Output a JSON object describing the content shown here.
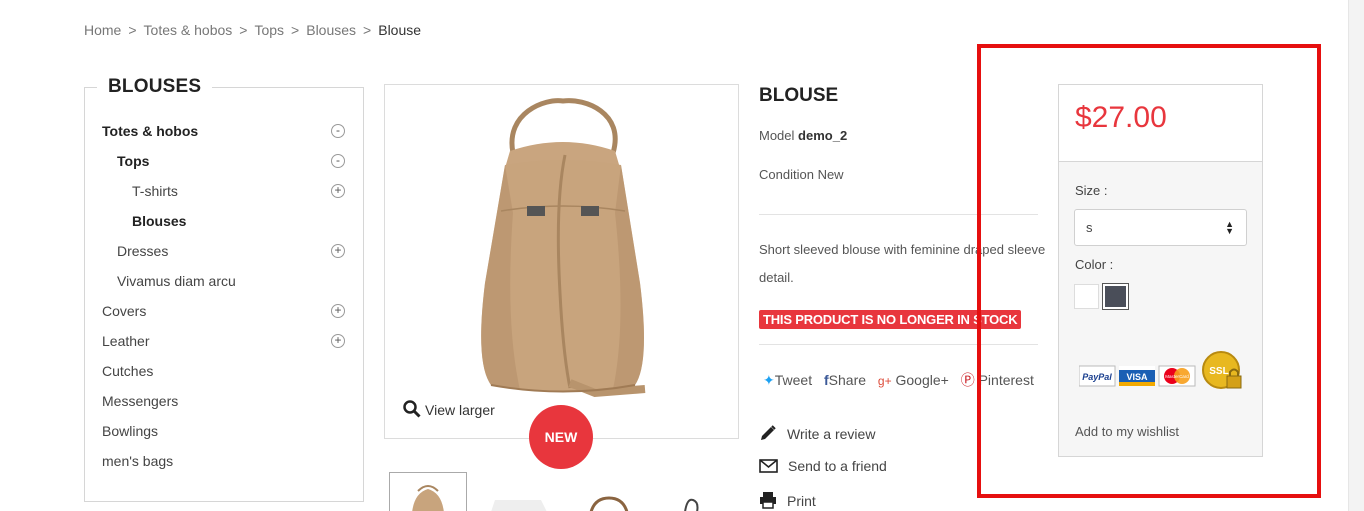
{
  "breadcrumb": {
    "items": [
      "Home",
      "Totes & hobos",
      "Tops",
      "Blouses"
    ],
    "current": "Blouse",
    "separator": ">"
  },
  "sidebar": {
    "title": "BLOUSES",
    "categories": [
      {
        "label": "Totes & hobos",
        "toggle": "-"
      },
      {
        "label": "Tops",
        "toggle": "-"
      },
      {
        "label": "T-shirts",
        "toggle": "+"
      },
      {
        "label": "Blouses",
        "toggle": ""
      },
      {
        "label": "Dresses",
        "toggle": "+"
      },
      {
        "label": "Vivamus diam arcu",
        "toggle": ""
      },
      {
        "label": "Covers",
        "toggle": "+"
      },
      {
        "label": "Leather",
        "toggle": "+"
      },
      {
        "label": "Cutches",
        "toggle": ""
      },
      {
        "label": "Messengers",
        "toggle": ""
      },
      {
        "label": "Bowlings",
        "toggle": ""
      },
      {
        "label": "men's bags",
        "toggle": ""
      }
    ]
  },
  "image": {
    "view_larger": "View larger",
    "badge": "NEW"
  },
  "product": {
    "title": "BLOUSE",
    "model_label": "Model",
    "model_value": "demo_2",
    "condition_label": "Condition",
    "condition_value": "New",
    "description": "Short sleeved blouse with feminine draped sleeve detail.",
    "stock_notice": "THIS PRODUCT IS NO LONGER IN STOCK",
    "share": {
      "tweet": "Tweet",
      "share": "Share",
      "google": "Google+",
      "pinterest": "Pinterest"
    },
    "actions": {
      "review": "Write a review",
      "friend": "Send to a friend",
      "print": "Print"
    }
  },
  "buy_box": {
    "price": "$27.00",
    "size_label": "Size :",
    "size_value": "S",
    "color_label": "Color :",
    "colors": [
      "#ffffff",
      "#4a4e59"
    ],
    "payment_logos": [
      "PayPal",
      "VISA",
      "MasterCard",
      "SSL"
    ],
    "wishlist": "Add to my wishlist"
  },
  "colors": {
    "accent": "#e8363d",
    "highlight": "#e60f0f"
  }
}
